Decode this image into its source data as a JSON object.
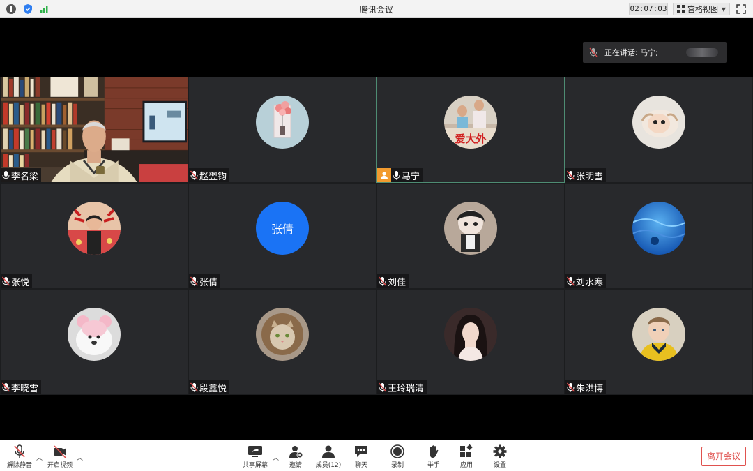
{
  "window": {
    "title": "腾讯会议",
    "timer": "02:07:03",
    "view_mode": "宫格视图"
  },
  "speaking_banner": {
    "text": "正在讲话: 马宁;"
  },
  "tiles": [
    {
      "name": "李名梁",
      "type": "video",
      "active": false
    },
    {
      "name": "赵翌钧",
      "type": "avatar",
      "avatar": "balloon-photo",
      "active": false
    },
    {
      "name": "马宁",
      "type": "avatar",
      "avatar": "kids-photo",
      "host": true,
      "active": true
    },
    {
      "name": "张明雪",
      "type": "avatar",
      "avatar": "cat-photo",
      "active": false
    },
    {
      "name": "张悦",
      "type": "avatar",
      "avatar": "girl-photo",
      "active": false
    },
    {
      "name": "张倩",
      "type": "text-avatar",
      "avatar_text": "张倩",
      "avatar_color": "#1a73f5",
      "active": false
    },
    {
      "name": "刘佳",
      "type": "avatar",
      "avatar": "plush-doll",
      "active": false
    },
    {
      "name": "刘水寒",
      "type": "avatar",
      "avatar": "blue-water",
      "active": false
    },
    {
      "name": "李晓雪",
      "type": "avatar",
      "avatar": "pink-bear",
      "active": false
    },
    {
      "name": "段鑫悦",
      "type": "avatar",
      "avatar": "lion-cat",
      "active": false
    },
    {
      "name": "王玲瑞清",
      "type": "avatar",
      "avatar": "woman-portrait",
      "active": false
    },
    {
      "name": "朱洪博",
      "type": "avatar",
      "avatar": "boy-portrait",
      "active": false
    }
  ],
  "toolbar": {
    "unmute": "解除静音",
    "start_video": "开启视频",
    "share_screen": "共享屏幕",
    "invite": "邀请",
    "members": "成员(12)",
    "chat": "聊天",
    "record": "录制",
    "raise_hand": "举手",
    "apps": "应用",
    "settings": "设置",
    "leave": "离开会议"
  },
  "colors": {
    "accent_blue": "#1a73f5",
    "leave_red": "#e0524f",
    "host_orange": "#f29b2f",
    "active_border": "#4e8c73"
  }
}
